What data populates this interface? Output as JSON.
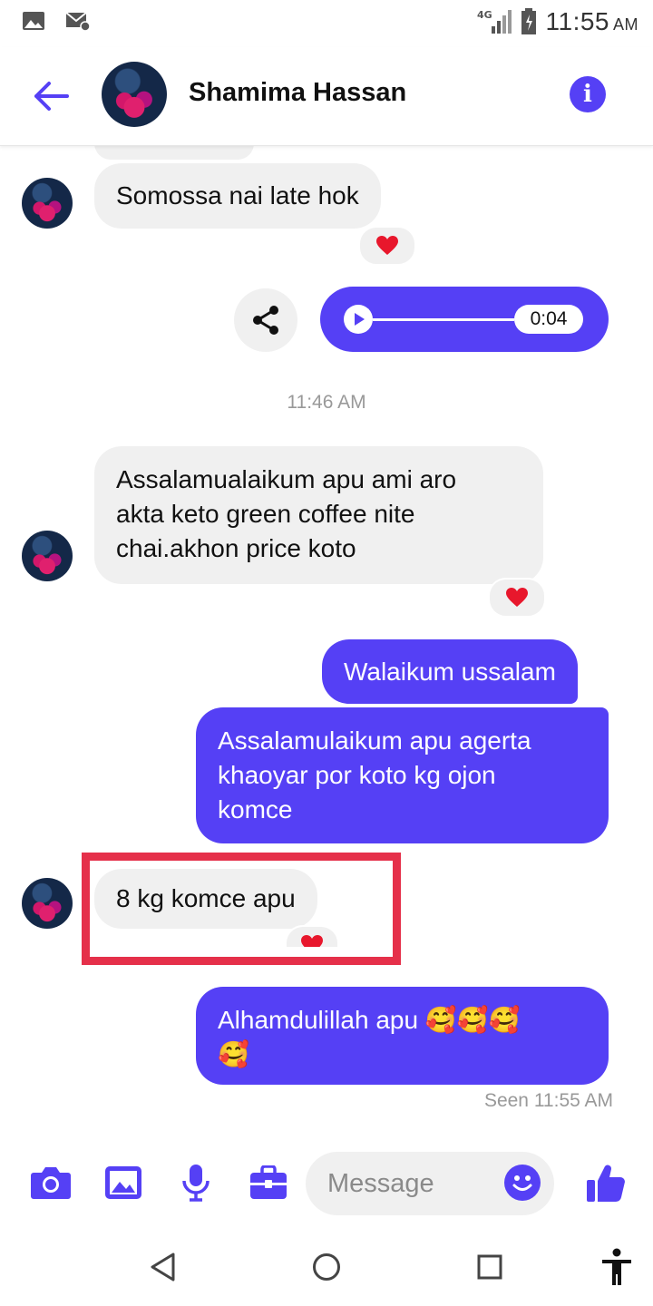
{
  "status": {
    "time": "11:55",
    "ampm": "AM",
    "network": "4G"
  },
  "header": {
    "contact_name": "Shamima Hassan"
  },
  "messages": {
    "m1": "Somossa nai late hok",
    "timestamp": "11:46 AM",
    "m2_line1": "Assalamualaikum apu ami aro",
    "m2_line2": "akta keto green coffee nite",
    "m2_line3": "chai.akhon price  koto",
    "m3": "Walaikum ussalam",
    "m4_line1": "Assalamulaikum apu agerta",
    "m4_line2": "khaoyar por koto kg ojon",
    "m4_line3": "komce",
    "m5": "8 kg komce apu",
    "m6_line1": "Alhamdulillah apu 🥰🥰🥰",
    "m6_line2": "🥰",
    "seen": "Seen 11:55 AM"
  },
  "audio": {
    "duration": "0:04",
    "progress": 0
  },
  "reaction": "❤️",
  "composer": {
    "placeholder": "Message"
  },
  "colors": {
    "accent": "#5540f5",
    "incoming": "#f0f0f0",
    "highlight": "#e5304a"
  },
  "icons": [
    "gallery-icon",
    "mail-icon",
    "signal-icon",
    "battery-icon",
    "back-arrow-icon",
    "info-icon",
    "share-icon",
    "play-icon",
    "camera-icon",
    "image-icon",
    "microphone-icon",
    "briefcase-icon",
    "emoji-icon",
    "like-icon",
    "nav-back-icon",
    "nav-home-icon",
    "nav-recents-icon",
    "accessibility-icon"
  ]
}
